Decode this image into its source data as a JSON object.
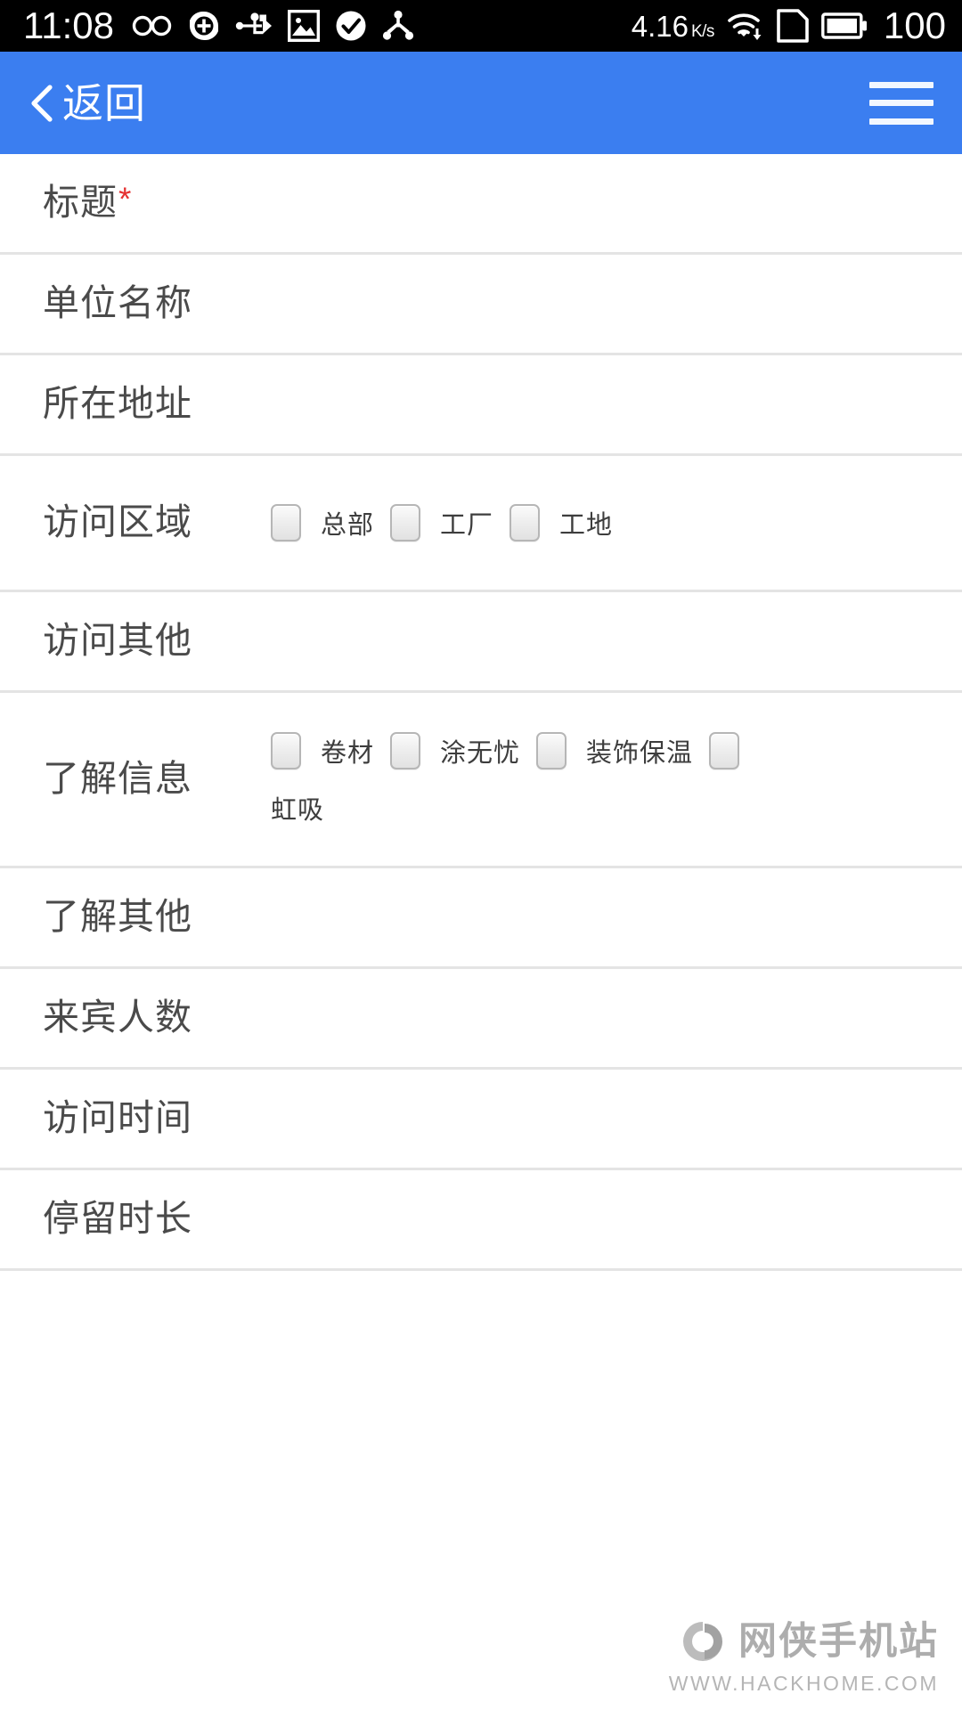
{
  "status_bar": {
    "time": "11:08",
    "network_speed": "4.16",
    "network_speed_unit": "K/s",
    "battery_level": "100",
    "icons": [
      "infinity-icon",
      "sync-add-icon",
      "usb-icon",
      "image-icon",
      "check-circle-icon",
      "share-nodes-icon",
      "wifi-download-icon",
      "sim-card-icon",
      "battery-icon"
    ]
  },
  "header": {
    "back_label": "返回",
    "back_icon": "chevron-left-icon",
    "menu_icon": "hamburger-menu-icon",
    "accent_color": "#3b7ef0"
  },
  "form": {
    "required_marker": "*",
    "rows": [
      {
        "name": "title",
        "label": "标题",
        "required": true,
        "type": "text",
        "value": "",
        "placeholder": ""
      },
      {
        "name": "company-name",
        "label": "单位名称",
        "required": false,
        "type": "text",
        "value": "",
        "placeholder": ""
      },
      {
        "name": "address",
        "label": "所在地址",
        "required": false,
        "type": "text",
        "value": "",
        "placeholder": ""
      },
      {
        "name": "visit-area",
        "label": "访问区域",
        "required": false,
        "type": "checkbox-group",
        "options": [
          {
            "label": "总部",
            "checked": false
          },
          {
            "label": "工厂",
            "checked": false
          },
          {
            "label": "工地",
            "checked": false
          }
        ]
      },
      {
        "name": "visit-other",
        "label": "访问其他",
        "required": false,
        "type": "text",
        "value": "",
        "placeholder": ""
      },
      {
        "name": "info-interest",
        "label": "了解信息",
        "required": false,
        "type": "checkbox-group",
        "options": [
          {
            "label": "卷材",
            "checked": false
          },
          {
            "label": "涂无忧",
            "checked": false
          },
          {
            "label": "装饰保温",
            "checked": false
          },
          {
            "label": "虹吸",
            "checked": false
          }
        ]
      },
      {
        "name": "info-other",
        "label": "了解其他",
        "required": false,
        "type": "text",
        "value": "",
        "placeholder": ""
      },
      {
        "name": "guest-count",
        "label": "来宾人数",
        "required": false,
        "type": "text",
        "value": "",
        "placeholder": ""
      },
      {
        "name": "visit-time",
        "label": "访问时间",
        "required": false,
        "type": "text",
        "value": "",
        "placeholder": ""
      },
      {
        "name": "stay-duration",
        "label": "停留时长",
        "required": false,
        "type": "text",
        "value": "",
        "placeholder": ""
      }
    ]
  },
  "watermark": {
    "site_name": "网侠手机站",
    "url": "WWW.HACKHOME.COM",
    "logo_icon": "hackhome-logo-icon"
  }
}
